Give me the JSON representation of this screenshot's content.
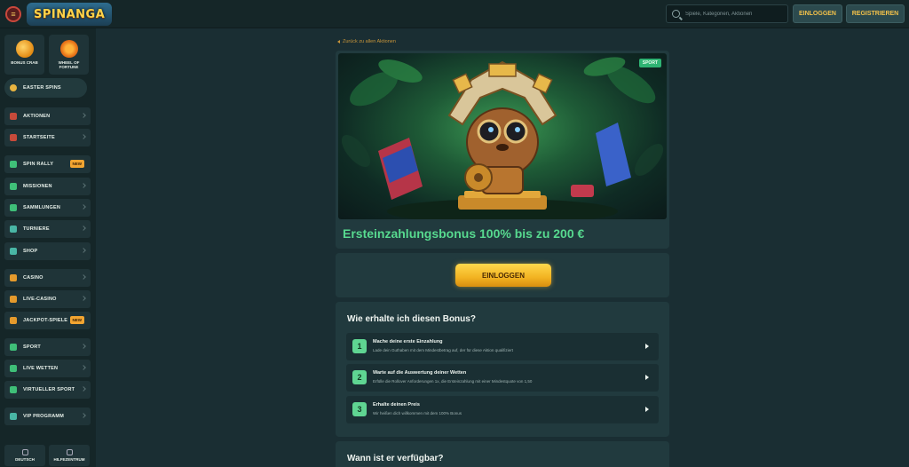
{
  "header": {
    "logo_text": "SPINANGA",
    "search_placeholder": "Spiele, Kategorien, Aktionen",
    "login_label": "EINLOGGEN",
    "register_label": "REGISTRIEREN"
  },
  "sidebar": {
    "quick": [
      {
        "label": "BONUS CRAB",
        "icon": "crab-icon"
      },
      {
        "label": "WHEEL OF FORTUNE",
        "icon": "wheel-icon"
      }
    ],
    "easter": {
      "label": "EASTER SPINS",
      "icon": "egg-icon"
    },
    "items": [
      {
        "label": "AKTIONEN",
        "icon": "gift-icon",
        "badge": ""
      },
      {
        "label": "STARTSEITE",
        "icon": "home-icon",
        "badge": ""
      },
      {
        "label": "SPIN RALLY",
        "icon": "rally-icon",
        "badge": "NEW"
      },
      {
        "label": "MISSIONEN",
        "icon": "mission-icon",
        "badge": ""
      },
      {
        "label": "SAMMLUNGEN",
        "icon": "collection-icon",
        "badge": ""
      },
      {
        "label": "TURNIERE",
        "icon": "trophy-icon",
        "badge": ""
      },
      {
        "label": "SHOP",
        "icon": "shop-icon",
        "badge": ""
      },
      {
        "label": "CASINO",
        "icon": "casino-icon",
        "badge": ""
      },
      {
        "label": "LIVE-CASINO",
        "icon": "live-casino-icon",
        "badge": ""
      },
      {
        "label": "JACKPOT-SPIELE",
        "icon": "jackpot-icon",
        "badge": "NEW"
      },
      {
        "label": "SPORT",
        "icon": "sport-icon",
        "badge": ""
      },
      {
        "label": "LIVE WETTEN",
        "icon": "live-bets-icon",
        "badge": ""
      },
      {
        "label": "VIRTUELLER SPORT",
        "icon": "virtual-sport-icon",
        "badge": ""
      },
      {
        "label": "VIP PROGRAMM",
        "icon": "vip-icon",
        "badge": ""
      }
    ],
    "bottom": [
      {
        "label": "DEUTSCH",
        "icon": "language-icon"
      },
      {
        "label": "HILFEZENTRUM",
        "icon": "help-icon"
      }
    ]
  },
  "main": {
    "back_link": "Zurück zu allen Aktionen",
    "promo": {
      "tag": "SPORT",
      "title": "Ersteinzahlungsbonus 100% bis zu 200 €"
    },
    "cta_label": "EINLOGGEN",
    "steps_heading": "Wie erhalte ich diesen Bonus?",
    "steps": [
      {
        "num": "1",
        "title": "Mache deine erste Einzahlung",
        "desc": "Lade dein Guthaben mit dem Mindestbetrag auf, der für diese Aktion qualifiziert"
      },
      {
        "num": "2",
        "title": "Warte auf die Auswertung deiner Wetten",
        "desc": "Erfülle die Rollover Anforderungen 1x, die Ersteinzahlung mit einer Mindestquote von 1,50"
      },
      {
        "num": "3",
        "title": "Erhalte deinen Preis",
        "desc": "Wir heißen dich willkommen mit dem 100% Bonus"
      }
    ],
    "availability_heading": "Wann ist er verfügbar?"
  }
}
